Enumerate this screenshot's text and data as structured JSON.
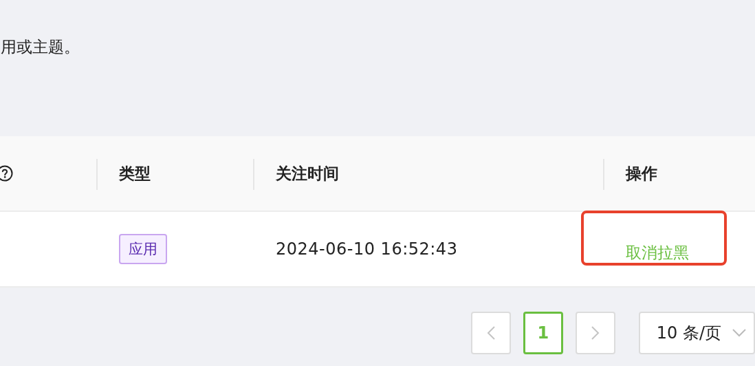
{
  "intro": "用或主题。",
  "table": {
    "columns": [
      {
        "help": true
      },
      {
        "label": "类型"
      },
      {
        "label": "关注时间"
      },
      {
        "label": "操作"
      }
    ],
    "rows": [
      {
        "type_tag": "应用",
        "followed_at": "2024-06-10 16:52:43",
        "action": {
          "label": "取消拉黑",
          "highlighted": true
        }
      }
    ]
  },
  "pagination": {
    "pages": [
      {
        "label": "1",
        "selected": true
      }
    ],
    "prev_disabled": true,
    "next_disabled": true,
    "page_size": "10 条/页"
  }
}
